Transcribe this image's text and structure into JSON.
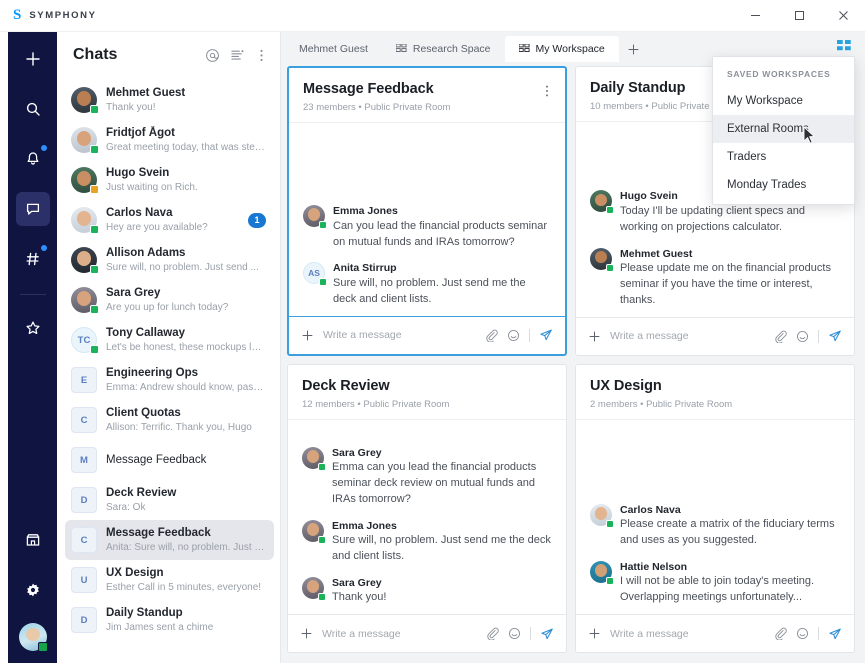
{
  "titlebar": {
    "logo_mark": "S",
    "app_name": "SYMPHONY",
    "minimize_label": "Minimize",
    "maximize_label": "Maximize",
    "close_label": "Close"
  },
  "rail": {
    "items": [
      {
        "name": "add",
        "icon": "plus-icon",
        "badge": false,
        "active": false
      },
      {
        "name": "search",
        "icon": "search-icon",
        "badge": false,
        "active": false
      },
      {
        "name": "notifications",
        "icon": "bell-icon",
        "badge": true,
        "active": false
      },
      {
        "name": "chats",
        "icon": "chat-bubble-icon",
        "badge": false,
        "active": true
      },
      {
        "name": "rooms",
        "icon": "hash-icon",
        "badge": true,
        "active": false
      },
      {
        "name": "favorites",
        "icon": "star-icon",
        "badge": false,
        "active": false
      }
    ],
    "bottom_items": [
      {
        "name": "marketplace",
        "icon": "store-icon"
      },
      {
        "name": "settings",
        "icon": "gear-icon"
      }
    ],
    "avatar_presence": "available"
  },
  "chat_panel": {
    "title": "Chats",
    "actions": [
      {
        "name": "mentions",
        "icon": "at-icon"
      },
      {
        "name": "filter-list",
        "icon": "list-filter-icon"
      },
      {
        "name": "more-options",
        "icon": "kebab-icon"
      }
    ],
    "items": [
      {
        "name": "Mehmet Guest",
        "preview": "Thank you!",
        "avatar": "photo",
        "face": "f1",
        "presence": "available",
        "unread": "",
        "bold": true,
        "selected": false
      },
      {
        "name": "Fridtjof Ågot",
        "preview": "Great meeting today, that was stellar.",
        "avatar": "photo",
        "face": "f2",
        "presence": "available",
        "unread": "",
        "bold": true,
        "selected": false
      },
      {
        "name": "Hugo Svein",
        "preview": "Just waiting on Rich.",
        "avatar": "photo",
        "face": "f3",
        "presence": "busy",
        "unread": "",
        "bold": true,
        "selected": false
      },
      {
        "name": "Carlos Nava",
        "preview": "Hey are you available?",
        "avatar": "photo",
        "face": "f4",
        "presence": "available",
        "unread": "1",
        "bold": true,
        "selected": false
      },
      {
        "name": "Allison Adams",
        "preview": "Sure will, no problem. Just send ...",
        "avatar": "photo",
        "face": "f5",
        "presence": "available",
        "unread": "",
        "bold": true,
        "selected": false
      },
      {
        "name": "Sara Grey",
        "preview": "Are you up for lunch today?",
        "avatar": "photo",
        "face": "f6",
        "presence": "available",
        "unread": "",
        "bold": true,
        "selected": false
      },
      {
        "name": "Tony Callaway",
        "preview": "Let's be honest, these mockups look gre...",
        "avatar": "initials",
        "initials": "TC",
        "shape": "round",
        "presence": "available",
        "unread": "",
        "bold": true,
        "selected": false
      },
      {
        "name": "Engineering Ops",
        "preview": "Emma: Andrew should know, pass...",
        "avatar": "initials",
        "initials": "E",
        "shape": "square",
        "presence": "none",
        "unread": "",
        "bold": true,
        "selected": false
      },
      {
        "name": "Client Quotas",
        "preview": "Allison: Terrific. Thank you, Hugo",
        "avatar": "initials",
        "initials": "C",
        "shape": "square",
        "presence": "none",
        "unread": "",
        "bold": true,
        "selected": false
      },
      {
        "name": "Message Feedback",
        "preview": "",
        "avatar": "initials",
        "initials": "M",
        "shape": "square",
        "presence": "none",
        "unread": "",
        "bold": false,
        "selected": false
      },
      {
        "name": "Deck Review",
        "preview": "Sara: Ok",
        "avatar": "initials",
        "initials": "D",
        "shape": "square",
        "presence": "none",
        "unread": "",
        "bold": true,
        "selected": false
      },
      {
        "name": "Message Feedback",
        "preview": "Anita: Sure will, no problem. Just send me...",
        "avatar": "initials",
        "initials": "C",
        "shape": "square",
        "presence": "none",
        "unread": "",
        "bold": true,
        "selected": true
      },
      {
        "name": "UX Design",
        "preview": "Esther Call in 5 minutes, everyone!",
        "avatar": "initials",
        "initials": "U",
        "shape": "square",
        "presence": "none",
        "unread": "",
        "bold": true,
        "selected": false
      },
      {
        "name": "Daily Standup",
        "preview": "Jim James sent a chime",
        "avatar": "initials",
        "initials": "D",
        "shape": "square",
        "presence": "none",
        "unread": "",
        "bold": true,
        "selected": false
      }
    ]
  },
  "tabs": {
    "items": [
      {
        "label": "Mehmet Guest",
        "icon": false,
        "active": false
      },
      {
        "label": "Research Space",
        "icon": true,
        "active": false
      },
      {
        "label": "My Workspace",
        "icon": true,
        "active": true
      }
    ],
    "new_tab_label": "+",
    "grid_toggle_name": "workspace-grid-toggle"
  },
  "dropdown": {
    "header": "SAVED WORKSPACES",
    "items": [
      {
        "label": "My Workspace",
        "hovered": false
      },
      {
        "label": "External Rooms",
        "hovered": true
      },
      {
        "label": "Traders",
        "hovered": false
      },
      {
        "label": "Monday Trades",
        "hovered": false
      }
    ]
  },
  "composer": {
    "placeholder": "Write a message",
    "plus_label": "+",
    "attach_name": "attach-icon",
    "emoji_name": "emoji-icon",
    "send_name": "send-icon"
  },
  "cards": [
    {
      "title": "Message Feedback",
      "subtitle": "23 members  •  Public Private Room",
      "focused": true,
      "messages": [
        {
          "author": "Emma Jones",
          "text": "Can you lead the financial products seminar on mutual funds and IRAs tomorrow?",
          "avatar": "photo",
          "face": "f6",
          "presence": "available"
        },
        {
          "author": "Anita Stirrup",
          "text": "Sure will, no problem. Just send me the deck and client lists.",
          "avatar": "initials",
          "initials": "AS",
          "shape": "round",
          "presence": "available"
        }
      ]
    },
    {
      "title": "Daily Standup",
      "subtitle": "10 members  •  Public Private Room",
      "focused": false,
      "messages": [
        {
          "author": "Hugo Svein",
          "text": "Today I'll be updating client specs and working on projections calculator.",
          "avatar": "photo",
          "face": "f3",
          "presence": "available"
        },
        {
          "author": "Mehmet Guest",
          "text": "Please update me on the financial products seminar if you have the time or interest, thanks.",
          "avatar": "photo",
          "face": "f1",
          "presence": "available"
        }
      ]
    },
    {
      "title": "Deck Review",
      "subtitle": "12 members  •  Public Private Room",
      "focused": false,
      "messages": [
        {
          "author": "Sara Grey",
          "text": "Emma can you lead the financial products seminar deck review on mutual funds and IRAs tomorrow?",
          "avatar": "photo",
          "face": "f6",
          "presence": "available"
        },
        {
          "author": "Emma Jones",
          "text": "Sure will, no problem. Just send me the deck and client lists.",
          "avatar": "photo",
          "face": "f6",
          "presence": "available"
        },
        {
          "author": "Sara Grey",
          "text": "Thank you!",
          "avatar": "photo",
          "face": "f6",
          "presence": "available"
        }
      ]
    },
    {
      "title": "UX Design",
      "subtitle": "2 members  •  Public Private Room",
      "focused": false,
      "messages": [
        {
          "author": "Carlos Nava",
          "text": "Please create a matrix of the fiduciary terms and uses as you suggested.",
          "avatar": "photo",
          "face": "f4",
          "presence": "available"
        },
        {
          "author": "Hattie Nelson",
          "text": "I will not be able to join today's meeting. Overlapping meetings unfortunately...",
          "avatar": "photo",
          "face": "f8",
          "presence": "available"
        }
      ]
    }
  ],
  "colors": {
    "rail_bg": "#0f1440",
    "accent_blue": "#1878d1",
    "focus_border": "#3b9ede",
    "send_blue": "#2f8fd6",
    "presence_available": "#19b45a",
    "presence_busy": "#e8a321"
  }
}
